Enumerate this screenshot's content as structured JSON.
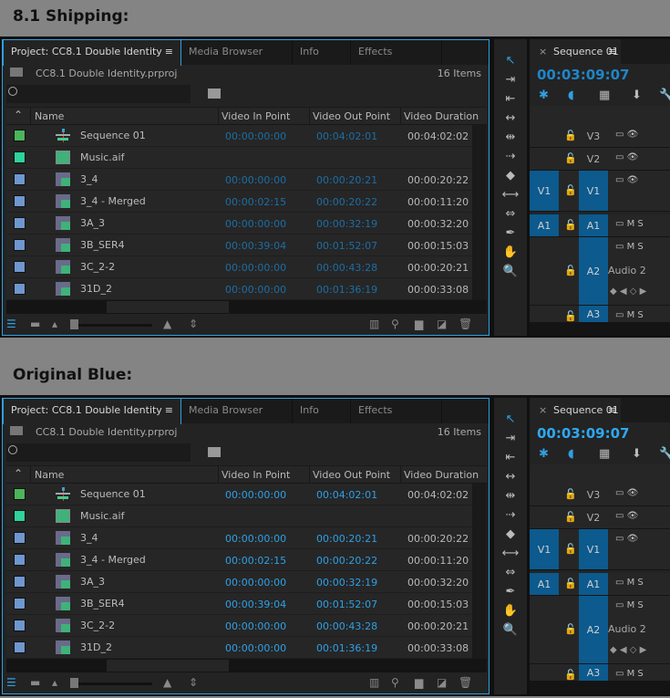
{
  "panels": [
    {
      "caption": "8.1 Shipping:",
      "timecode_color": "#1c6ea6",
      "playhead_color": "#1f86c8"
    },
    {
      "caption": "Original Blue:",
      "timecode_color": "#2ea0e6",
      "playhead_color": "#2ea8f0"
    }
  ],
  "project": {
    "tabs": [
      "Project: CC8.1 Double Identity",
      "Media Browser",
      "Info",
      "Effects"
    ],
    "menu_icon": "≡",
    "path": "CC8.1 Double Identity.prproj",
    "item_count": "16 Items",
    "search_placeholder": "",
    "columns": [
      "Name",
      "Video In Point",
      "Video Out Point",
      "Video Duration"
    ],
    "rows": [
      {
        "color": "#4bb55a",
        "icon": "sequence-icon",
        "name": "Sequence 01",
        "in": "00:00:00:00",
        "out": "00:04:02:01",
        "dur": "00:04:02:02"
      },
      {
        "color": "#2ed39a",
        "icon": "audio-clip-icon",
        "name": "Music.aif",
        "in": "",
        "out": "",
        "dur": ""
      },
      {
        "color": "#6f97cf",
        "icon": "av-clip-icon",
        "name": "3_4",
        "in": "00:00:00:00",
        "out": "00:00:20:21",
        "dur": "00:00:20:22"
      },
      {
        "color": "#6f97cf",
        "icon": "av-clip-icon",
        "name": "3_4 - Merged",
        "in": "00:00:02:15",
        "out": "00:00:20:22",
        "dur": "00:00:11:20"
      },
      {
        "color": "#6f97cf",
        "icon": "av-clip-icon",
        "name": "3A_3",
        "in": "00:00:00:00",
        "out": "00:00:32:19",
        "dur": "00:00:32:20"
      },
      {
        "color": "#6f97cf",
        "icon": "av-clip-icon",
        "name": "3B_SER4",
        "in": "00:00:39:04",
        "out": "00:01:52:07",
        "dur": "00:00:15:03"
      },
      {
        "color": "#6f97cf",
        "icon": "av-clip-icon",
        "name": "3C_2-2",
        "in": "00:00:00:00",
        "out": "00:00:43:28",
        "dur": "00:00:20:21"
      },
      {
        "color": "#6f97cf",
        "icon": "av-clip-icon",
        "name": "31D_2",
        "in": "00:00:00:00",
        "out": "00:01:36:19",
        "dur": "00:00:33:08"
      }
    ]
  },
  "timeline": {
    "tab": "Sequence 01",
    "close": "×",
    "menu_icon": "≡",
    "timecode": "00:03:09:07",
    "tracks": [
      {
        "src": "",
        "label": "V3",
        "src_on": false,
        "lab_on": false,
        "icons": "▭ 👁"
      },
      {
        "src": "",
        "label": "V2",
        "src_on": false,
        "lab_on": false,
        "icons": "▭ 👁"
      },
      {
        "src": "V1",
        "label": "V1",
        "src_on": true,
        "lab_on": true,
        "icons": "▭ 👁"
      },
      {
        "src": "A1",
        "label": "A1",
        "src_on": true,
        "lab_on": true,
        "icons": "▭ M S"
      },
      {
        "src": "",
        "label": "A2",
        "src_on": false,
        "lab_on": true,
        "icons": "▭ M S",
        "name": "Audio 2"
      },
      {
        "src": "",
        "label": "A3",
        "src_on": false,
        "lab_on": true,
        "icons": "▭ M S"
      }
    ]
  }
}
